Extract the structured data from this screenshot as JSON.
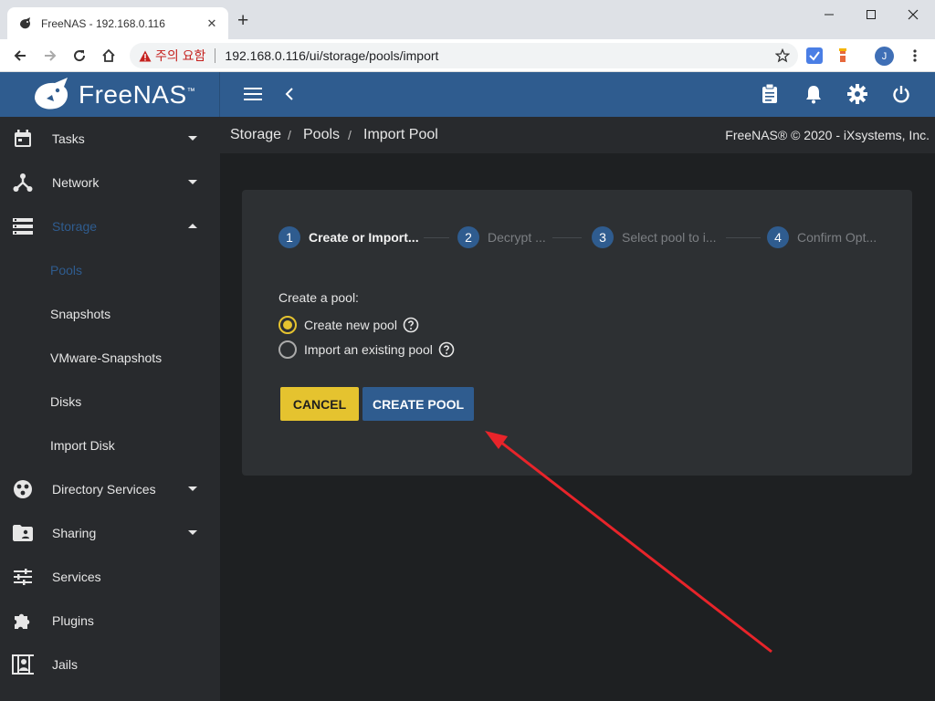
{
  "browser": {
    "tab_title": "FreeNAS - 192.168.0.116",
    "tab_close": "✕",
    "new_tab": "+",
    "security_label": "주의 요함",
    "url": "192.168.0.116/ui/storage/pools/import",
    "avatar_letter": "J"
  },
  "header": {
    "logo_text": "FreeNAS",
    "logo_tm": "™"
  },
  "sidebar": {
    "items": [
      {
        "label": "Tasks"
      },
      {
        "label": "Network"
      },
      {
        "label": "Storage"
      },
      {
        "label": "Directory Services"
      },
      {
        "label": "Sharing"
      },
      {
        "label": "Services"
      },
      {
        "label": "Plugins"
      },
      {
        "label": "Jails"
      }
    ],
    "storage_sub": [
      {
        "label": "Pools"
      },
      {
        "label": "Snapshots"
      },
      {
        "label": "VMware-Snapshots"
      },
      {
        "label": "Disks"
      },
      {
        "label": "Import Disk"
      }
    ]
  },
  "breadcrumb": {
    "items": [
      "Storage",
      "Pools",
      "Import Pool"
    ],
    "separator": "/",
    "copyright": "FreeNAS® © 2020 - iXsystems, Inc."
  },
  "wizard": {
    "steps": [
      {
        "num": "1",
        "label": "Create or Import..."
      },
      {
        "num": "2",
        "label": "Decrypt ..."
      },
      {
        "num": "3",
        "label": "Select pool to i..."
      },
      {
        "num": "4",
        "label": "Confirm Opt..."
      }
    ],
    "form_label": "Create a pool:",
    "options": [
      {
        "label": "Create new pool",
        "checked": true
      },
      {
        "label": "Import an existing pool",
        "checked": false
      }
    ],
    "cancel_label": "CANCEL",
    "create_label": "CREATE POOL"
  },
  "colors": {
    "header_blue": "#2f5c8f",
    "accent_yellow": "#e5c32f",
    "sidebar_bg": "#282a2d",
    "annotation_red": "#e8242a"
  }
}
